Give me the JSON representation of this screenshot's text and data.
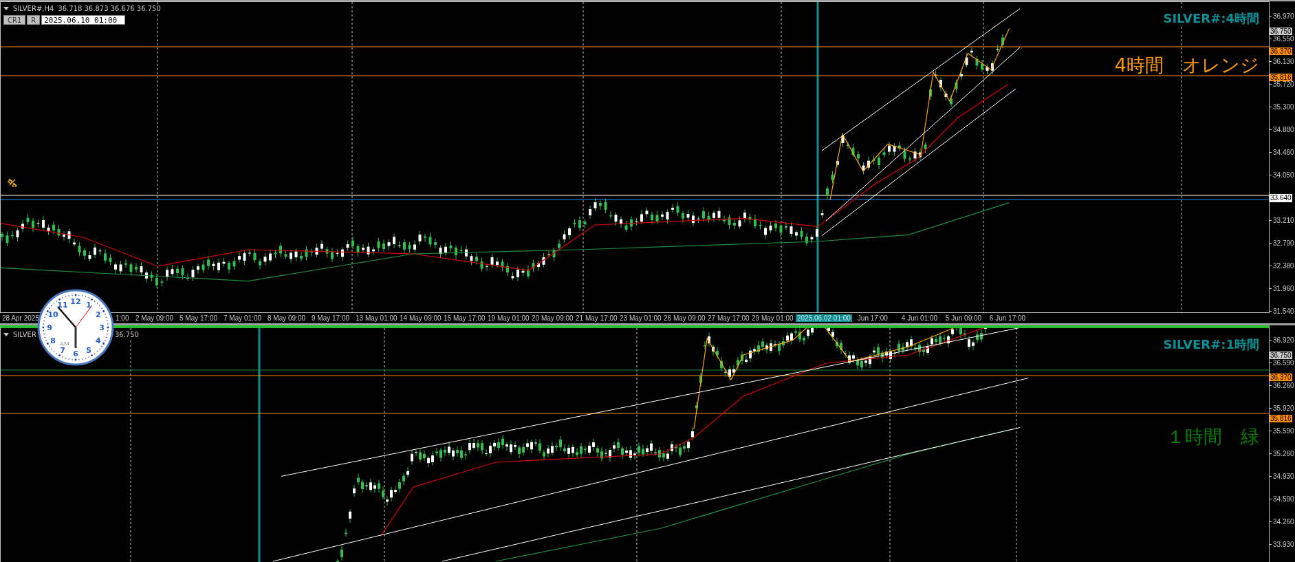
{
  "panels": [
    {
      "kind": "main",
      "header": {
        "symbol": "SILVER#,H4",
        "quote": "36.718 36.873 36.676 36.750"
      },
      "toolbar": {
        "buttons": [
          "CR1",
          "R"
        ],
        "date_value": "2025.06.10 01:00"
      },
      "title": "SILVER#:4時間",
      "note": {
        "text": "4時間　オレンジ",
        "color": "#ff9900"
      },
      "axis": [
        {
          "text": "36.970",
          "kind": "tick"
        },
        {
          "text": "36.750",
          "kind": "last"
        },
        {
          "text": "36.550",
          "kind": "tick"
        },
        {
          "text": "36.370",
          "kind": "level"
        },
        {
          "text": "36.130",
          "kind": "tick"
        },
        {
          "text": "35.816",
          "kind": "level"
        },
        {
          "text": "35.720",
          "kind": "tick"
        },
        {
          "text": "35.300",
          "kind": "tick"
        },
        {
          "text": "34.880",
          "kind": "tick"
        },
        {
          "text": "34.460",
          "kind": "tick"
        },
        {
          "text": "34.050",
          "kind": "tick"
        },
        {
          "text": "33.640",
          "kind": "line"
        },
        {
          "text": "33.210",
          "kind": "tick"
        },
        {
          "text": "32.790",
          "kind": "tick"
        },
        {
          "text": "32.380",
          "kind": "tick"
        },
        {
          "text": "31.960",
          "kind": "tick"
        },
        {
          "text": "31.540",
          "kind": "tick"
        }
      ],
      "time_axis": [
        {
          "text": "28 Apr 2025",
          "highlighted": false
        },
        {
          "text": "1:00",
          "highlighted": false
        },
        {
          "text": "2 May 09:00",
          "highlighted": false
        },
        {
          "text": "5 May 17:00",
          "highlighted": false
        },
        {
          "text": "7 May 01:00",
          "highlighted": false
        },
        {
          "text": "8 May 09:00",
          "highlighted": false
        },
        {
          "text": "9 May 17:00",
          "highlighted": false
        },
        {
          "text": "13 May 01:00",
          "highlighted": false
        },
        {
          "text": "14 May 09:00",
          "highlighted": false
        },
        {
          "text": "15 May 17:00",
          "highlighted": false
        },
        {
          "text": "19 May 01:00",
          "highlighted": false
        },
        {
          "text": "20 May 09:00",
          "highlighted": false
        },
        {
          "text": "21 May 17:00",
          "highlighted": false
        },
        {
          "text": "23 May 01:00",
          "highlighted": false
        },
        {
          "text": "26 May 09:00",
          "highlighted": false
        },
        {
          "text": "27 May 17:00",
          "highlighted": false
        },
        {
          "text": "29 May 01:00",
          "highlighted": false
        },
        {
          "text": "2025.06.02 01:00",
          "highlighted": true
        },
        {
          "text": "Jun 17:00",
          "highlighted": false
        },
        {
          "text": "4 Jun 01:00",
          "highlighted": false
        },
        {
          "text": "5 Jun 09:00",
          "highlighted": false
        },
        {
          "text": "6 Jun 17:00",
          "highlighted": false
        }
      ]
    },
    {
      "kind": "sub",
      "header": {
        "symbol": "SILVER",
        "quote": "36.750"
      },
      "title": "SILVER#:1時間",
      "note": {
        "text": "１時間　緑",
        "color": "#008000"
      },
      "axis": [
        {
          "text": "36.920",
          "kind": "tick"
        },
        {
          "text": "36.750",
          "kind": "last"
        },
        {
          "text": "36.590",
          "kind": "tick"
        },
        {
          "text": "36.370",
          "kind": "level"
        },
        {
          "text": "36.260",
          "kind": "tick"
        },
        {
          "text": "35.920",
          "kind": "tick"
        },
        {
          "text": "35.816",
          "kind": "level"
        },
        {
          "text": "35.590",
          "kind": "tick"
        },
        {
          "text": "35.260",
          "kind": "tick"
        },
        {
          "text": "34.930",
          "kind": "tick"
        },
        {
          "text": "34.590",
          "kind": "tick"
        },
        {
          "text": "34.260",
          "kind": "tick"
        },
        {
          "text": "33.930",
          "kind": "tick"
        }
      ]
    }
  ],
  "clock": {
    "numerals": [
      "12",
      "11",
      "1",
      "10",
      "2",
      "9",
      "3",
      "8",
      "4",
      "7",
      "5",
      "6"
    ],
    "meridiem": "AM"
  }
}
